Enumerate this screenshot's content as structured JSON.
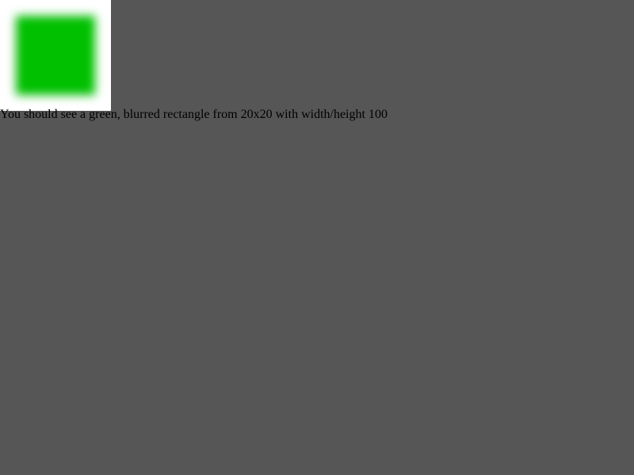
{
  "canvas": {
    "background_color": "#ffffff",
    "rect_color": "#00c000",
    "blurred": true
  },
  "caption": {
    "text": "You should see a green, blurred rectangle from 20x20 with width/height 100"
  },
  "page": {
    "background_color": "#565656"
  }
}
